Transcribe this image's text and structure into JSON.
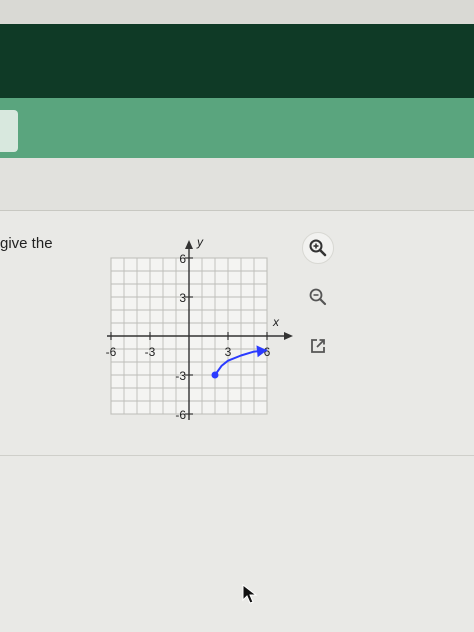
{
  "question": {
    "text": "give the"
  },
  "graph": {
    "x_axis_label": "x",
    "y_axis_label": "y",
    "x_ticks": [
      "-6",
      "-3",
      "3",
      "6"
    ],
    "y_ticks": [
      "6",
      "3",
      "-3",
      "-6"
    ]
  },
  "chart_data": {
    "type": "line",
    "xlabel": "x",
    "ylabel": "y",
    "xlim": [
      -6,
      6
    ],
    "ylim": [
      -6,
      6
    ],
    "grid": true,
    "series": [
      {
        "x": [
          2,
          2.5,
          3,
          4,
          5,
          6
        ],
        "y": [
          -3,
          -2.3,
          -1.9,
          -1.5,
          -1.2,
          -1.1
        ]
      }
    ]
  },
  "toolbar": {
    "zoom_in_icon": "zoom-in-icon",
    "zoom_out_icon": "zoom-out-icon",
    "open_external_icon": "open-external-icon"
  },
  "colors": {
    "header": "#0f3a26",
    "band": "#5aa57e",
    "curve": "#2b3bff"
  }
}
